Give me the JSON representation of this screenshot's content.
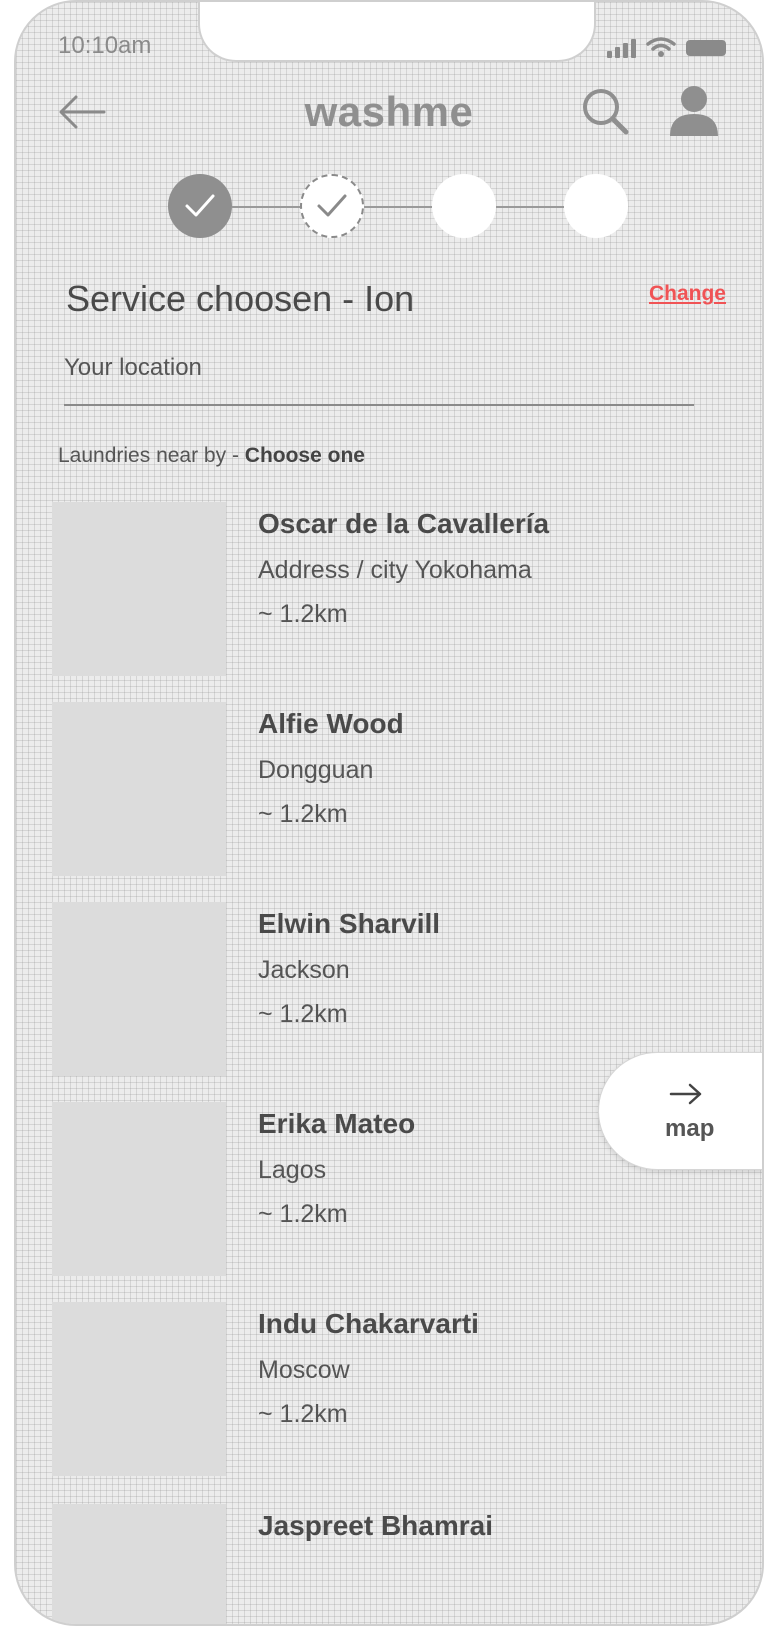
{
  "status_bar": {
    "time": "10:10am"
  },
  "header": {
    "logo": "washme"
  },
  "stepper": {
    "steps": [
      "done",
      "current",
      "todo",
      "todo"
    ]
  },
  "service": {
    "title": "Service choosen - Ion",
    "change_label": "Change"
  },
  "location": {
    "placeholder": "Your location"
  },
  "nearby": {
    "prefix": "Laundries near by - ",
    "emphasis": "Choose one"
  },
  "laundries": [
    {
      "name": "Oscar de la Cavallería",
      "city": "Address  / city Yokohama",
      "distance": "~ 1.2km"
    },
    {
      "name": "Alfie Wood",
      "city": "Dongguan",
      "distance": "~ 1.2km"
    },
    {
      "name": "Elwin Sharvill",
      "city": "Jackson",
      "distance": "~ 1.2km"
    },
    {
      "name": "Erika Mateo",
      "city": "Lagos",
      "distance": "~ 1.2km"
    },
    {
      "name": "Indu Chakarvarti",
      "city": "Moscow",
      "distance": "~ 1.2km"
    },
    {
      "name": "Jaspreet Bhamrai",
      "city": "",
      "distance": ""
    }
  ],
  "map_button": {
    "label": "map"
  },
  "colors": {
    "accent": "#f05355",
    "text": "#4a4a4a",
    "muted": "#8f8f8f",
    "placeholder_image": "#dcdcdc"
  }
}
